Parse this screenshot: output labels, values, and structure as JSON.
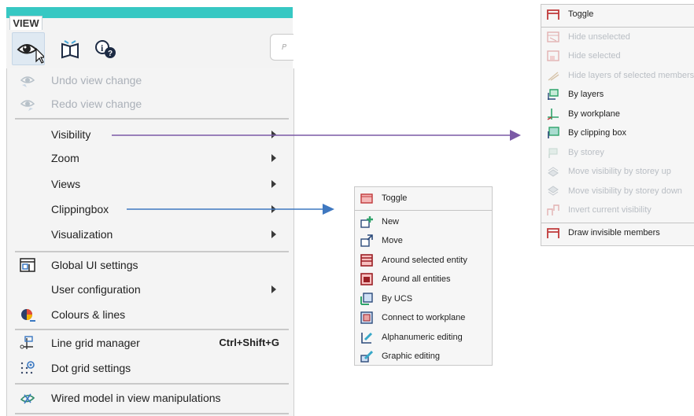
{
  "ribbon": {
    "tab_label": "VIEW",
    "partial_tab_label": "P",
    "buttons": [
      {
        "name": "eye-icon",
        "hovered": true
      },
      {
        "name": "book-icon"
      },
      {
        "name": "info-icon"
      }
    ]
  },
  "main_menu": {
    "items": [
      {
        "label": "Undo view change",
        "enabled": false,
        "icon": "eye-undo-icon"
      },
      {
        "label": "Redo view change",
        "enabled": false,
        "icon": "eye-redo-icon"
      },
      {
        "label": "Visibility",
        "enabled": true,
        "submenu": true
      },
      {
        "label": "Zoom",
        "enabled": true,
        "submenu": true
      },
      {
        "label": "Views",
        "enabled": true,
        "submenu": true
      },
      {
        "label": "Clippingbox",
        "enabled": true,
        "submenu": true
      },
      {
        "label": "Visualization",
        "enabled": true,
        "submenu": true
      },
      {
        "label": "Global UI settings",
        "enabled": true,
        "icon": "ui-settings-icon"
      },
      {
        "label": "User configuration",
        "enabled": true,
        "submenu": true
      },
      {
        "label": "Colours & lines",
        "enabled": true,
        "icon": "colours-icon"
      },
      {
        "label": "Line grid manager",
        "enabled": true,
        "icon": "line-grid-icon",
        "shortcut": "Ctrl+Shift+G"
      },
      {
        "label": "Dot grid settings",
        "enabled": true,
        "icon": "dot-grid-icon"
      },
      {
        "label": "Wired model in view manipulations",
        "enabled": true,
        "icon": "wired-model-icon"
      }
    ]
  },
  "clipping_submenu": {
    "items": [
      {
        "label": "Toggle",
        "icon": "toggle-clip-icon"
      },
      {
        "label": "New",
        "icon": "new-clip-icon"
      },
      {
        "label": "Move",
        "icon": "move-clip-icon"
      },
      {
        "label": "Around selected entity",
        "icon": "around-selected-icon"
      },
      {
        "label": "Around all entities",
        "icon": "around-all-icon"
      },
      {
        "label": "By UCS",
        "icon": "by-ucs-icon"
      },
      {
        "label": "Connect to workplane",
        "icon": "connect-workplane-icon"
      },
      {
        "label": "Alphanumeric editing",
        "icon": "alphanumeric-edit-icon"
      },
      {
        "label": "Graphic editing",
        "icon": "graphic-edit-icon"
      }
    ]
  },
  "visibility_submenu": {
    "items": [
      {
        "label": "Toggle",
        "enabled": true
      },
      {
        "label": "Hide unselected",
        "enabled": false
      },
      {
        "label": "Hide selected",
        "enabled": false
      },
      {
        "label": "Hide layers of selected members",
        "enabled": false
      },
      {
        "label": "By layers",
        "enabled": true
      },
      {
        "label": "By workplane",
        "enabled": true
      },
      {
        "label": "By clipping box",
        "enabled": true
      },
      {
        "label": "By storey",
        "enabled": false
      },
      {
        "label": "Move visibility by storey up",
        "enabled": false
      },
      {
        "label": "Move visibility by storey down",
        "enabled": false
      },
      {
        "label": "Invert current visibility",
        "enabled": false
      },
      {
        "label": "Draw invisible members",
        "enabled": true
      }
    ]
  },
  "colors": {
    "ribbon_accent": "#37c8c3",
    "visibility_arrow": "#7b5aa6",
    "clipping_arrow": "#3f78c0"
  }
}
